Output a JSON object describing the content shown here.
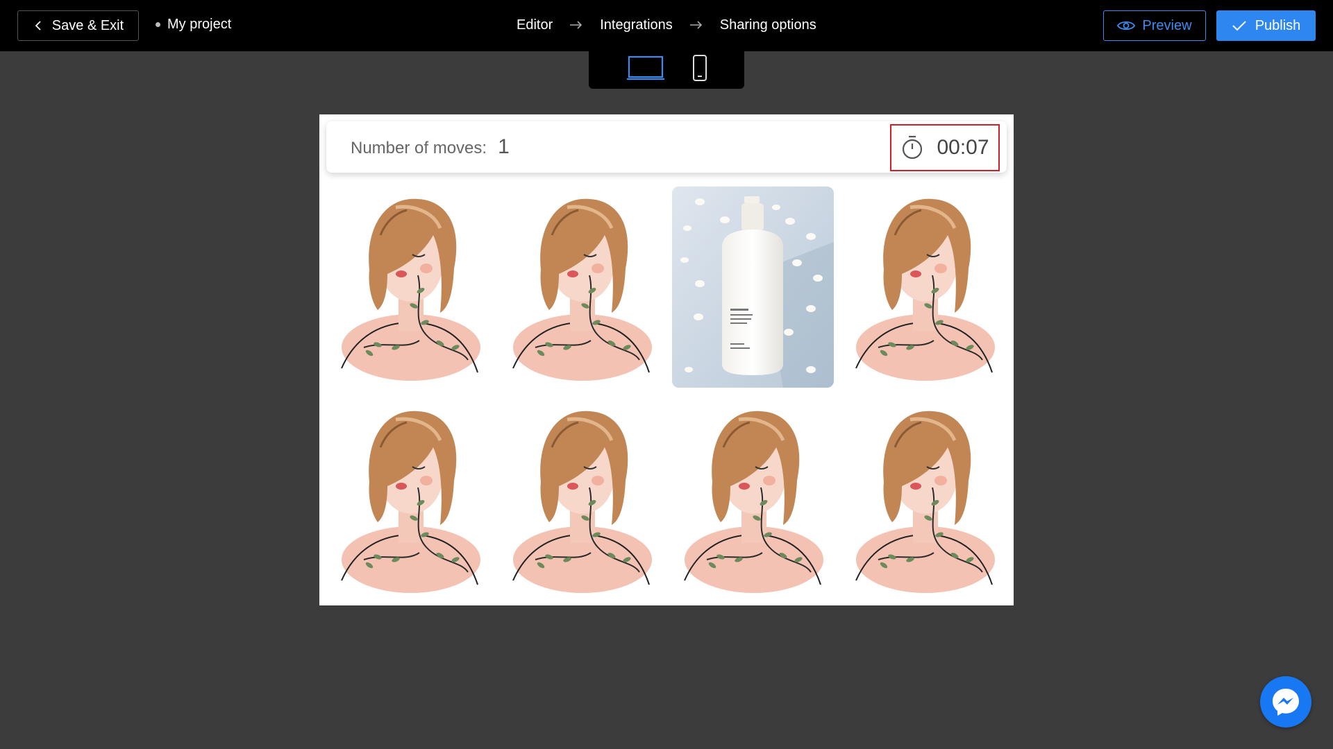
{
  "topbar": {
    "back_label": "Save & Exit",
    "project_name": "My project",
    "steps": [
      "Editor",
      "Integrations",
      "Sharing options"
    ],
    "preview_label": "Preview",
    "publish_label": "Publish"
  },
  "device_switch": {
    "options": [
      "desktop",
      "mobile"
    ],
    "selected": "desktop"
  },
  "game": {
    "moves_label": "Number of moves:",
    "moves_value": "1",
    "timer_value": "00:07",
    "grid": {
      "rows": 2,
      "columns": 4
    },
    "cards": [
      {
        "state": "face-down",
        "image": "woman-illustration"
      },
      {
        "state": "face-down",
        "image": "woman-illustration"
      },
      {
        "state": "face-up",
        "image": "lotion-bottle-photo"
      },
      {
        "state": "face-down",
        "image": "woman-illustration"
      },
      {
        "state": "face-down",
        "image": "woman-illustration"
      },
      {
        "state": "face-down",
        "image": "woman-illustration"
      },
      {
        "state": "face-down",
        "image": "woman-illustration"
      },
      {
        "state": "face-down",
        "image": "woman-illustration"
      }
    ]
  },
  "colors": {
    "accent": "#2e86f0",
    "timer_highlight": "#d11f2a",
    "canvas_background": "#3c3c3c"
  }
}
